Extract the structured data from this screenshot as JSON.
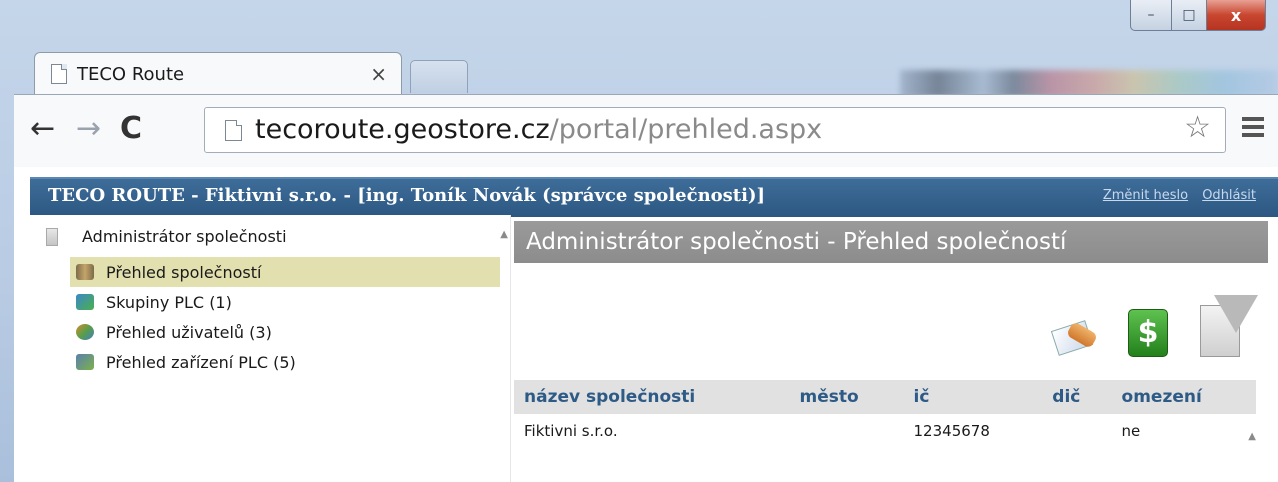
{
  "browser": {
    "tab_title": "TECO Route",
    "tab_close": "×",
    "url_host": "tecoroute.geostore.cz",
    "url_path": "/portal/prehled.aspx",
    "window_controls": {
      "minimize": "–",
      "maximize": "□",
      "close": "x"
    },
    "nav": {
      "back": "←",
      "forward": "→",
      "reload": "C",
      "bookmark": "☆"
    }
  },
  "appbar": {
    "title": "TECO ROUTE - Fiktivni s.r.o. - [ing. Toník Novák (správce společnosti)]",
    "change_password": "Změnit heslo",
    "logout": "Odhlásit"
  },
  "sidebar": {
    "root_label": "Administrátor společnosti",
    "items": [
      {
        "label": "Přehled společností",
        "icon": "companies-icon",
        "selected": true
      },
      {
        "label": "Skupiny PLC (1)",
        "icon": "groups-icon",
        "selected": false
      },
      {
        "label": "Přehled uživatelů (3)",
        "icon": "users-icon",
        "selected": false
      },
      {
        "label": "Přehled zařízení PLC (5)",
        "icon": "devices-icon",
        "selected": false
      }
    ]
  },
  "main": {
    "header": "Administrátor společnosti - Přehled společností",
    "actions": [
      {
        "icon": "edit-icon"
      },
      {
        "icon": "money-icon",
        "glyph": "$"
      },
      {
        "icon": "filter-icon"
      }
    ],
    "table": {
      "columns": [
        "název společnosti",
        "město",
        "ič",
        "dič",
        "omezení"
      ],
      "rows": [
        [
          "Fiktivni s.r.o.",
          "",
          "12345678",
          "",
          "ne"
        ]
      ]
    }
  },
  "colors": {
    "appbar": "#2c5782",
    "header_gray": "#8c8c8c",
    "selected_row": "#e3e0b0",
    "column_header_text": "#2e5a86"
  }
}
